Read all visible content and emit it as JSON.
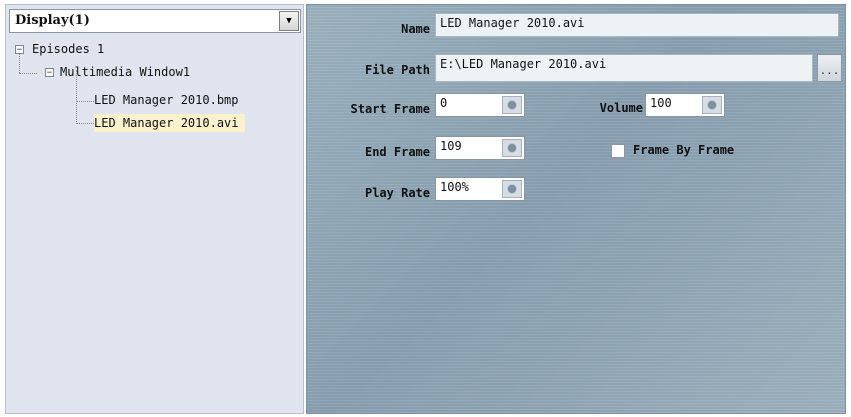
{
  "display": {
    "label": "Display(1)"
  },
  "tree": {
    "root": "Episodes 1",
    "child": "Multimedia Window1",
    "items": [
      "LED Manager 2010.bmp",
      "LED Manager 2010.avi"
    ],
    "selected": "LED Manager 2010.avi"
  },
  "form": {
    "name_label": "Name",
    "name_value": "LED Manager 2010.avi",
    "file_path_label": "File Path",
    "file_path_value": "E:\\LED Manager 2010.avi",
    "browse_label": "...",
    "start_frame_label": "Start Frame",
    "start_frame_value": "0",
    "end_frame_label": "End Frame",
    "end_frame_value": "109",
    "play_rate_label": "Play Rate",
    "play_rate_value": "100%",
    "volume_label": "Volume",
    "volume_value": "100",
    "frame_by_frame_label": "Frame By Frame",
    "frame_by_frame_checked": false
  }
}
